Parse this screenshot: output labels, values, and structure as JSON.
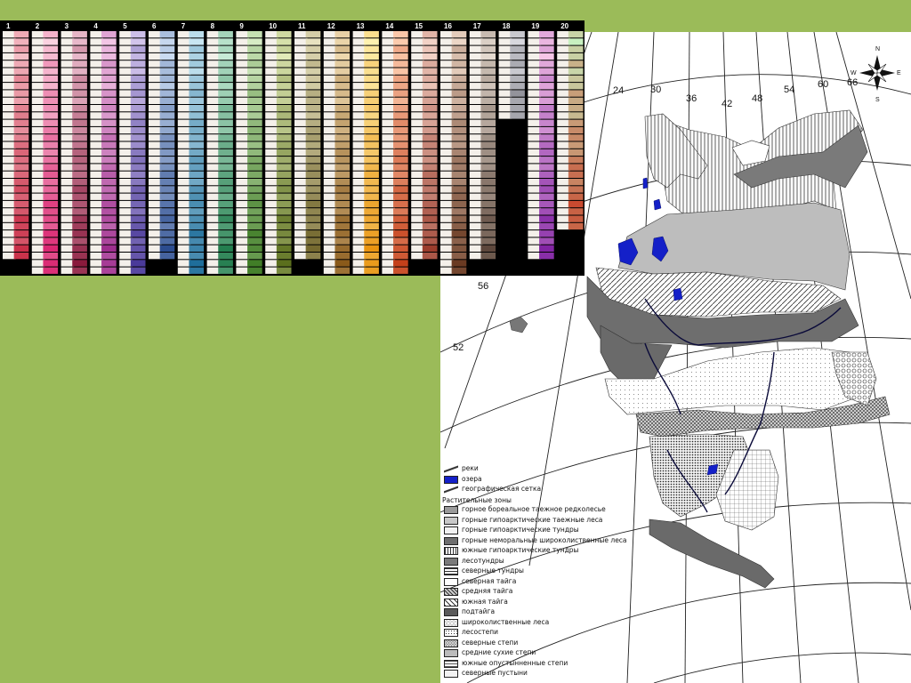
{
  "slide": {
    "background": "#9bbb59"
  },
  "palette": {
    "column_numbers": [
      "1",
      "2",
      "3",
      "4",
      "5",
      "6",
      "7",
      "8",
      "9",
      "10",
      "11",
      "12",
      "13",
      "14",
      "15",
      "16",
      "17",
      "18",
      "19",
      "20"
    ],
    "column_colors": [
      [
        "#f7c4cc",
        "#c4203a"
      ],
      [
        "#fbd2e0",
        "#d81b6a"
      ],
      [
        "#f0c6d6",
        "#8a1a3c"
      ],
      [
        "#f3c6e6",
        "#9c2a8c"
      ],
      [
        "#d6c8ee",
        "#4a3a9a"
      ],
      [
        "#cfe0f4",
        "#2a4a8e"
      ],
      [
        "#c8e6f2",
        "#1f6e9a"
      ],
      [
        "#c8ecd8",
        "#1e7a4a"
      ],
      [
        "#d6ecc4",
        "#3c7a22"
      ],
      [
        "#e6eebc",
        "#5a6e1c"
      ],
      [
        "#e8e2c0",
        "#6a5e22"
      ],
      [
        "#f4e0b8",
        "#8a5a1a"
      ],
      [
        "#fff2b0",
        "#e8900a"
      ],
      [
        "#ffd2b4",
        "#c4401a"
      ],
      [
        "#f6d8cc",
        "#9a3a2a"
      ],
      [
        "#ecd6c6",
        "#6a3a22"
      ],
      [
        "#e6dcd2",
        "#5a4438"
      ],
      [
        "#d8d8de",
        "#2e2e38"
      ],
      [
        "#f8c8e8",
        "#7a1aa0"
      ],
      [
        "#c8f0c0",
        "#c8200c"
      ]
    ]
  },
  "map": {
    "longitudes": [
      "24",
      "30",
      "36",
      "42",
      "48",
      "54",
      "60",
      "66"
    ],
    "latitudes": [
      "56",
      "52"
    ],
    "compass": {
      "n": "N",
      "s": "S",
      "e": "E",
      "w": "W"
    },
    "lakes_color": "#1420c8"
  },
  "legend": {
    "items_top": [
      {
        "label": "реки",
        "pattern": "rivers"
      },
      {
        "label": "озера",
        "pattern": "lakes"
      },
      {
        "label": "географическая сетка",
        "pattern": "grid"
      }
    ],
    "zones_heading": "Растительные зоны",
    "zones": [
      {
        "label": "горное бореальное таежное редколесье",
        "pattern": "gray-mid"
      },
      {
        "label": "горные гипоарктические таежные леса",
        "pattern": "gray-light"
      },
      {
        "label": "горные гипоарктические    тундры",
        "pattern": "dots-light"
      },
      {
        "label": "горные неморальные широколиственные леса",
        "pattern": "gray-dark"
      },
      {
        "label": "южные гипоарктические тундры",
        "pattern": "vlines"
      },
      {
        "label": "лесотундры",
        "pattern": "gray-dark2"
      },
      {
        "label": "северные тундры",
        "pattern": "hlines"
      },
      {
        "label": "северная тайга",
        "pattern": "white"
      },
      {
        "label": "средняя тайга",
        "pattern": "diag-dense"
      },
      {
        "label": "южная тайга",
        "pattern": "diag"
      },
      {
        "label": "подтайга",
        "pattern": "gray-darkest"
      },
      {
        "label": "широколиственные леса",
        "pattern": "circles"
      },
      {
        "label": "лесостепи",
        "pattern": "dots"
      },
      {
        "label": "северные степи",
        "pattern": "circles-dense"
      },
      {
        "label": "средние сухие степи",
        "pattern": "dots-dense"
      },
      {
        "label": "южные опустынненные степи",
        "pattern": "grid-fine"
      },
      {
        "label": "северные пустыни",
        "pattern": "dots-light"
      }
    ]
  }
}
